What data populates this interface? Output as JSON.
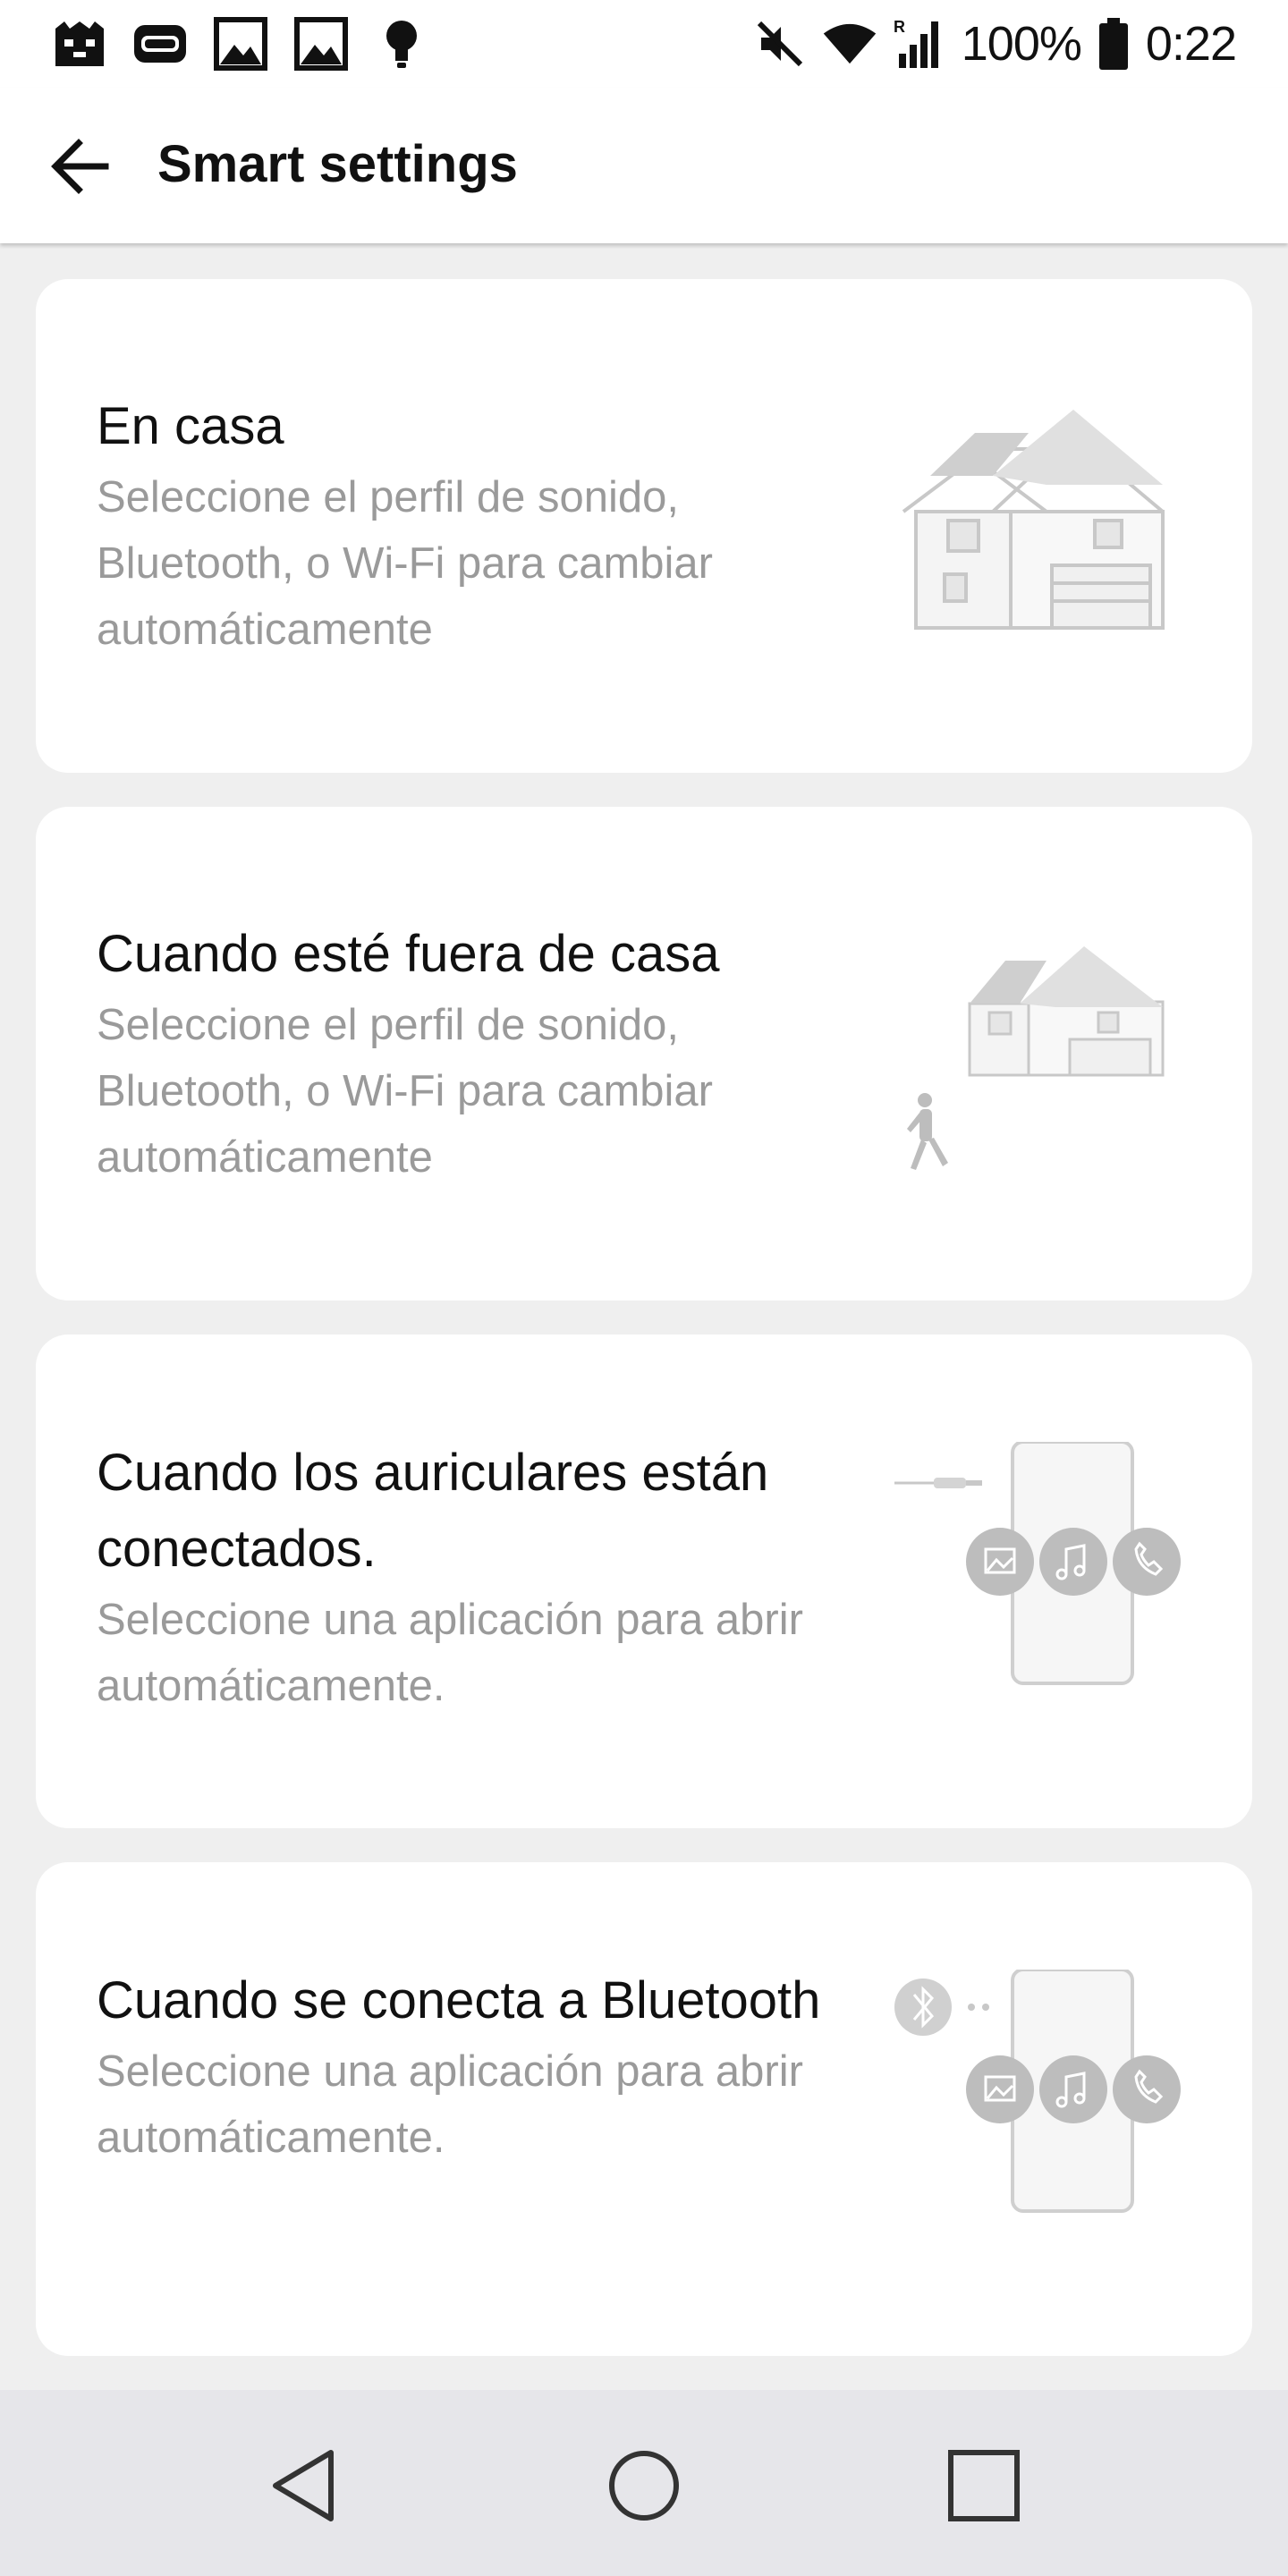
{
  "status_bar": {
    "left_icons": [
      "game-icon",
      "app-icon",
      "gallery-icon",
      "gallery-icon",
      "bulb-icon"
    ],
    "battery_percent": "100%",
    "time": "0:22",
    "icons": [
      "mute-icon",
      "wifi-icon",
      "signal-roaming-icon",
      "battery-icon"
    ]
  },
  "app_bar": {
    "title": "Smart settings",
    "back_icon": "arrow-left-icon"
  },
  "cards": [
    {
      "title": "En casa",
      "description": "Seleccione el perfil de sonido, Bluetooth, o Wi-Fi para cambiar automáticamente",
      "illustration": "house-icon"
    },
    {
      "title": "Cuando esté fuera de casa",
      "description": "Seleccione el perfil de sonido, Bluetooth, o Wi-Fi para cambiar automáticamente",
      "illustration": "walking-away-from-house-icon"
    },
    {
      "title": "Cuando los auriculares están conectados.",
      "description": "Seleccione una aplicación para abrir automáticamente.",
      "illustration": "earphones-phone-icon"
    },
    {
      "title": "Cuando se conecta a Bluetooth",
      "description": "Seleccione una aplicación para abrir automáticamente.",
      "illustration": "bluetooth-phone-icon"
    }
  ],
  "nav_bar": {
    "back": "nav-back-icon",
    "home": "nav-home-icon",
    "recents": "nav-recents-icon"
  },
  "colors": {
    "background": "#efefef",
    "card": "#ffffff",
    "title_text": "#111111",
    "description_text": "#9a9a9a",
    "illustration": "#c8c8c8",
    "navbar": "#e6e6ea"
  }
}
